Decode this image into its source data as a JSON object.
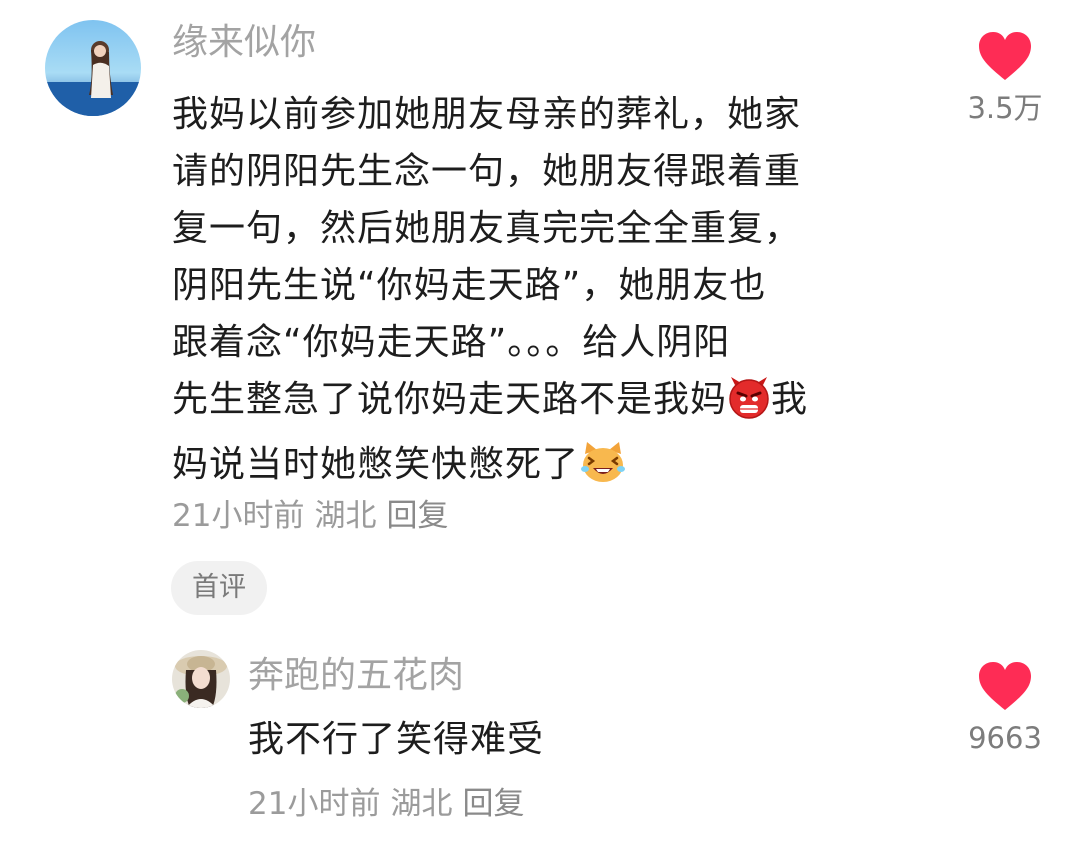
{
  "comment": {
    "username": "缘来似你",
    "lines": [
      "我妈以前参加她朋友母亲的葬礼，她家",
      "请的阴阳先生念一句，她朋友得跟着重",
      "复一句，然后她朋友真完完全全重复，",
      "阴阳先生说“你妈走天路”，她朋友也",
      "跟着念“你妈走天路”。。。给人阴阳",
      "先生整急了说你妈走天路不是我妈",
      "我",
      "妈说当时她憋笑快憋死了"
    ],
    "emojis": [
      "angry-face-emoji",
      "laughing-cat-emoji"
    ],
    "time": "21小时前",
    "location": "湖北",
    "reply_label": "回复",
    "badge": "首评",
    "like_count": "3.5万",
    "like_color": "#fe2c55"
  },
  "reply": {
    "username": "奔跑的五花肉",
    "text": "我不行了笑得难受",
    "time": "21小时前",
    "location": "湖北",
    "reply_label": "回复",
    "like_count": "9663",
    "like_color": "#fe2c55"
  }
}
